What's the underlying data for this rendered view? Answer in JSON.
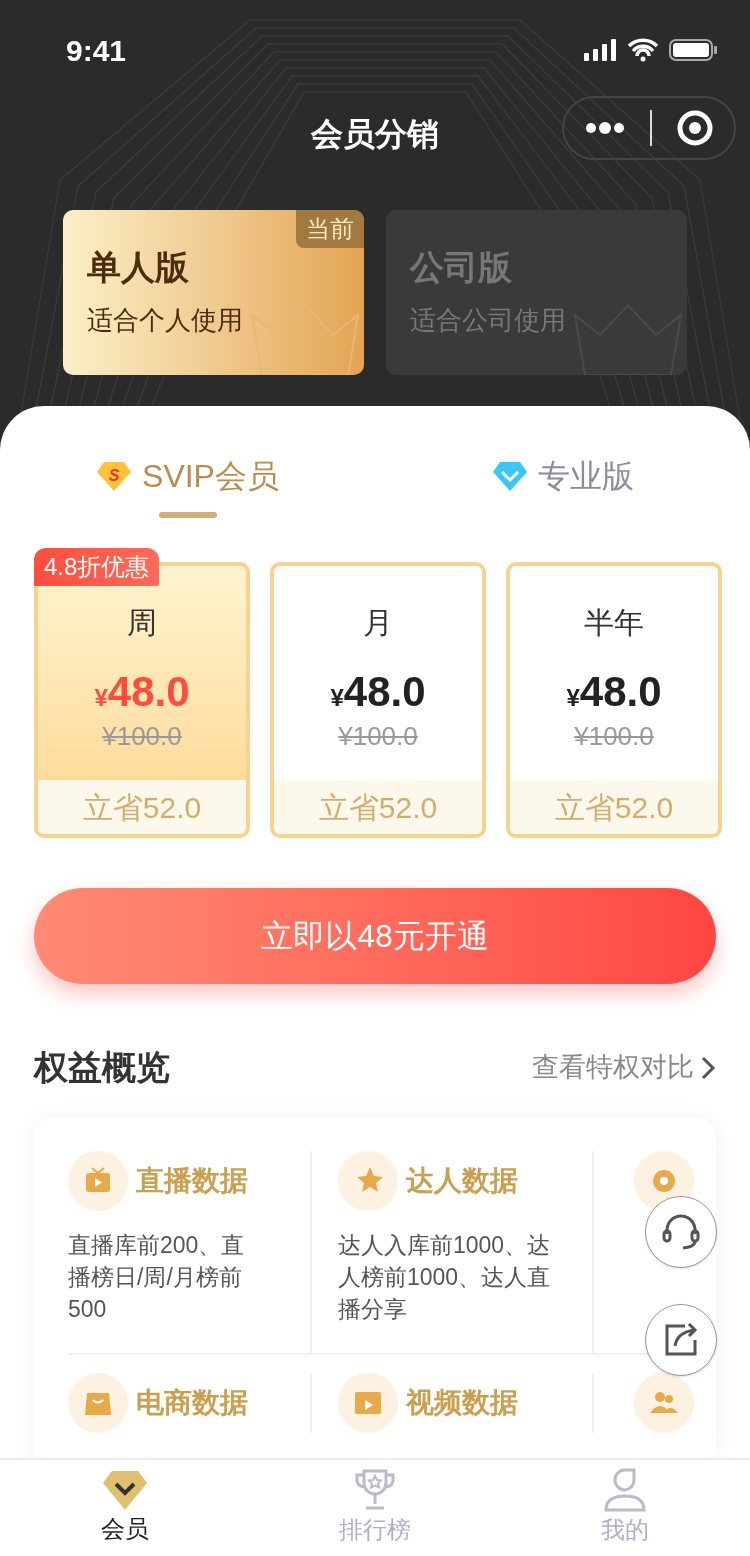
{
  "status_bar": {
    "time": "9:41"
  },
  "nav": {
    "title": "会员分销"
  },
  "editions": [
    {
      "name": "单人版",
      "desc": "适合个人使用",
      "selected": true,
      "badge": "当前"
    },
    {
      "name": "公司版",
      "desc": "适合公司使用",
      "selected": false
    }
  ],
  "tabs": [
    {
      "label": "SVIP会员",
      "kind": "svip",
      "mark": "S",
      "selected": true
    },
    {
      "label": "专业版",
      "kind": "pro",
      "selected": false
    }
  ],
  "plans": [
    {
      "period": "周",
      "currency": "¥",
      "price": "48.0",
      "original": "¥100.0",
      "saving": "立省52.0",
      "selected": true,
      "badge": "4.8折优惠"
    },
    {
      "period": "月",
      "currency": "¥",
      "price": "48.0",
      "original": "¥100.0",
      "saving": "立省52.0",
      "selected": false
    },
    {
      "period": "半年",
      "currency": "¥",
      "price": "48.0",
      "original": "¥100.0",
      "saving": "立省52.0",
      "selected": false
    }
  ],
  "buy_button": "立即以48元开通",
  "benefits": {
    "title": "权益概览",
    "link": "查看特权对比",
    "rows": [
      [
        {
          "kind": "tv",
          "title": "直播数据",
          "desc_lines": [
            "直播库前200、直",
            "播榜日/周/月榜前",
            "500"
          ]
        },
        {
          "kind": "star",
          "title": "达人数据",
          "desc_lines": [
            "达人入库前1000、达",
            "人榜前1000、达人直",
            "播分享"
          ]
        },
        {
          "kind": "coin"
        }
      ],
      [
        {
          "kind": "bag",
          "title": "电商数据"
        },
        {
          "kind": "video",
          "title": "视频数据"
        },
        {
          "kind": "people"
        }
      ]
    ]
  },
  "tabbar": [
    {
      "label": "会员",
      "kind": "diamond",
      "selected": true
    },
    {
      "label": "排行榜",
      "kind": "trophy",
      "selected": false
    },
    {
      "label": "我的",
      "kind": "user",
      "selected": false
    }
  ]
}
